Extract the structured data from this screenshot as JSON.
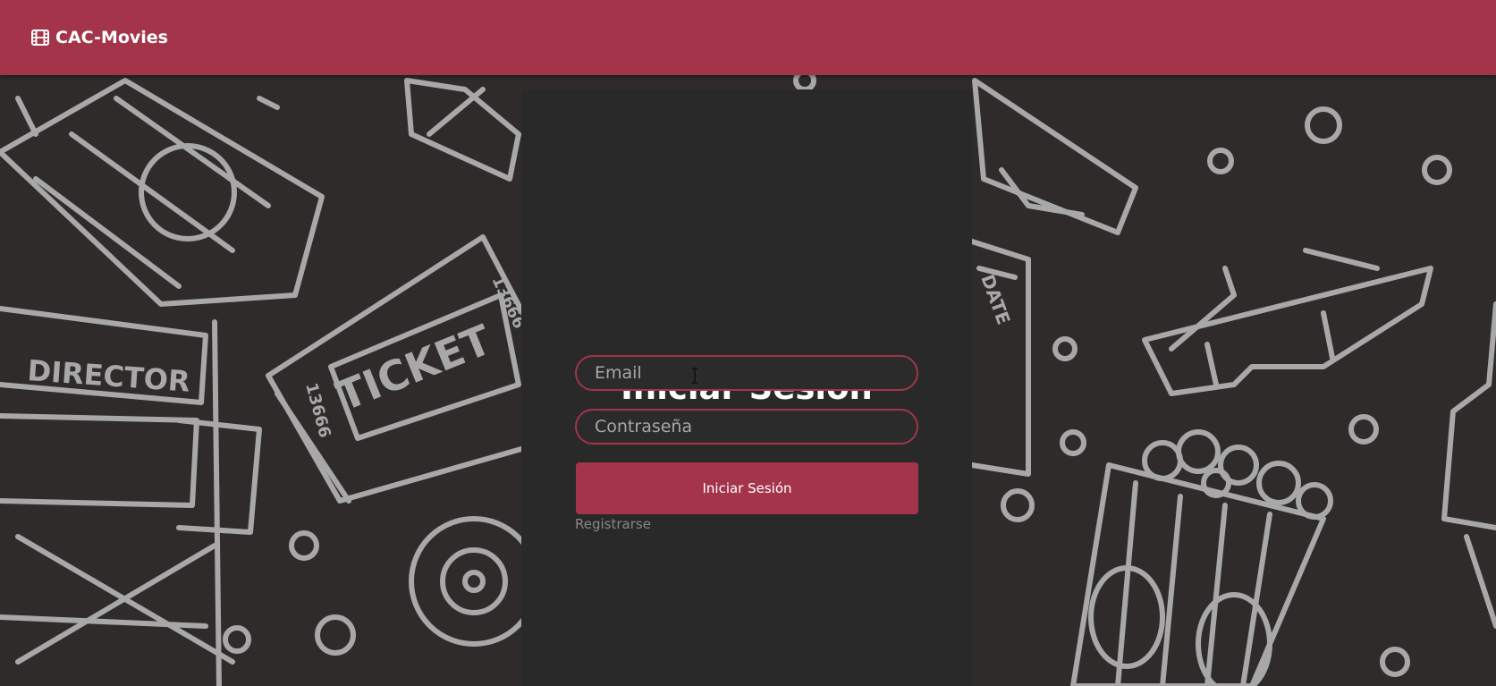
{
  "navbar": {
    "brand": "CAC-Movies",
    "brand_icon": "film-icon",
    "color": "#a3344a"
  },
  "background": {
    "theme": "cinema-doodles",
    "texts": {
      "director": "DIRECTOR",
      "ticket": "TICKET",
      "ticket_number_top": "13666",
      "ticket_number_bottom": "13666",
      "date": "DATE"
    }
  },
  "login": {
    "title": "Iniciar Sesión",
    "email_placeholder": "Email",
    "password_placeholder": "Contraseña",
    "submit_label": "Iniciar Sesión",
    "register_link": "Registrarse"
  },
  "colors": {
    "accent": "#a3344a",
    "panel": "#292929",
    "background": "#2f2b2b",
    "doodle": "#a8a8a8"
  }
}
